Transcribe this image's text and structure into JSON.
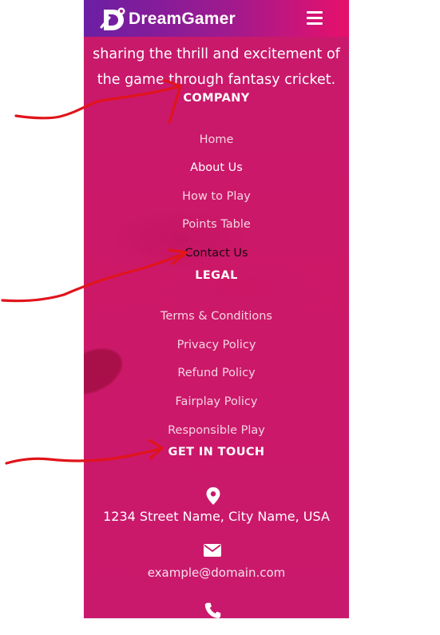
{
  "header": {
    "brand": "DreamGamer",
    "logo_icon": "dreamgamer-logo-icon",
    "menu_icon": "hamburger-menu-icon",
    "gradient": [
      "#6a1fa4",
      "#e8106b"
    ]
  },
  "intro": {
    "line1": "sharing the thrill and excitement of",
    "line2": "the game through fantasy cricket."
  },
  "company": {
    "title": "COMPANY",
    "links": [
      "Home",
      "About Us",
      "How to Play",
      "Points Table",
      "Contact Us"
    ]
  },
  "legal": {
    "title": "LEGAL",
    "links": [
      "Terms & Conditions",
      "Privacy Policy",
      "Refund Policy",
      "Fairplay Policy",
      "Responsible Play"
    ]
  },
  "contact": {
    "title": "GET IN TOUCH",
    "address": "1234 Street Name, City Name, USA",
    "email": "example@domain.com",
    "icons": [
      "location-pin-icon",
      "envelope-icon",
      "phone-icon"
    ]
  },
  "colors": {
    "background": "#c91768",
    "annotation": "#e0141b"
  }
}
